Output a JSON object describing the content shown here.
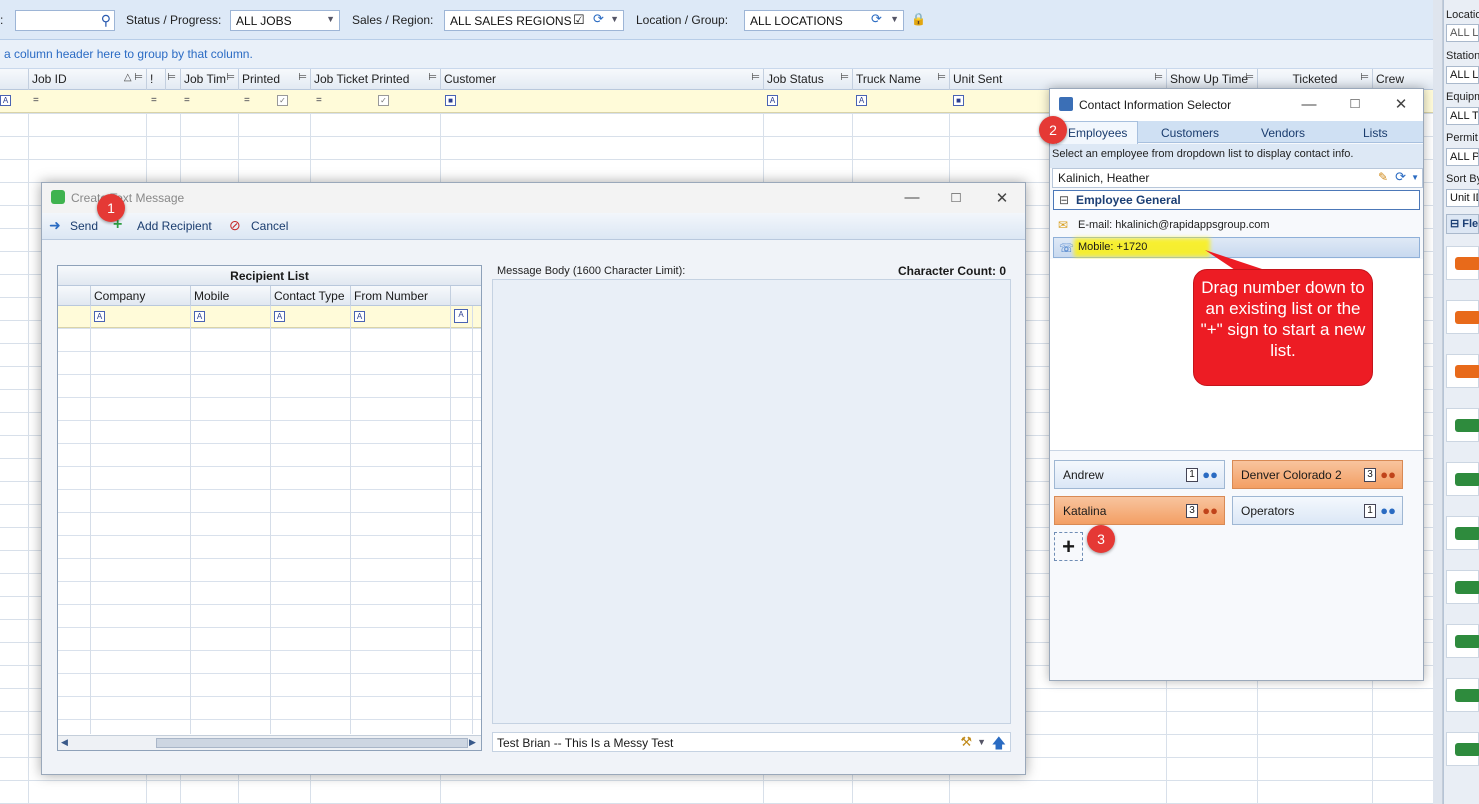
{
  "toolbar": {
    "status_label": "Status / Progress:",
    "status_value": "ALL JOBS",
    "sales_label": "Sales / Region:",
    "sales_value": "ALL SALES REGIONS",
    "location_label": "Location / Group:",
    "location_value": "ALL LOCATIONS"
  },
  "grid": {
    "group_hint": "a column header here to group by that column.",
    "columns": [
      "Job ID",
      "!",
      "Job Tim",
      "Printed",
      "Job Ticket Printed",
      "Customer",
      "Job Status",
      "Truck Name",
      "Unit Sent",
      "Show Up Time",
      "Ticketed",
      "Crew"
    ]
  },
  "right_panel": {
    "labels": [
      "Locatio",
      "Station",
      "Equipm",
      "Permit",
      "Sort By",
      "Fle"
    ],
    "values": [
      "ALL LO",
      "ALL LO",
      "ALL T",
      "ALL P",
      "Unit ID"
    ]
  },
  "create_message": {
    "title": "Create Text Message",
    "send": "Send",
    "add_recipient": "Add Recipient",
    "cancel": "Cancel",
    "recipient_list_title": "Recipient List",
    "columns": [
      "Company",
      "Mobile",
      "Contact Type",
      "From Number"
    ],
    "message_body_label": "Message Body (1600 Character Limit):",
    "character_count_label": "Character Count: 0",
    "template_value": "Test Brian -- This Is a Messy Test"
  },
  "contact_selector": {
    "title": "Contact Information Selector",
    "tabs": [
      "Employees",
      "Customers",
      "Vendors",
      "Lists"
    ],
    "hint": "Select an employee from dropdown list to display contact info.",
    "selected_employee": "Kalinich, Heather",
    "group_title": "Employee General",
    "email": "E-mail: hkalinich@rapidappsgroup.com",
    "mobile": "Mobile: +1720",
    "lists": [
      {
        "name": "Andrew",
        "count": "1",
        "color": "blue"
      },
      {
        "name": "Denver Colorado 2",
        "count": "3",
        "color": "orange"
      },
      {
        "name": "Katalina",
        "count": "3",
        "color": "orange"
      },
      {
        "name": "Operators",
        "count": "1",
        "color": "blue"
      }
    ],
    "plus": "+"
  },
  "annotations": {
    "badge1": "1",
    "badge2": "2",
    "badge3": "3",
    "callout": "Drag number down to an existing list or the \"+\" sign to start a new list."
  },
  "colors": {
    "accent": "#2b6bc4",
    "callout": "#ed1c24",
    "list_orange": "#f39f64",
    "list_blue": "#dbe7f6"
  }
}
